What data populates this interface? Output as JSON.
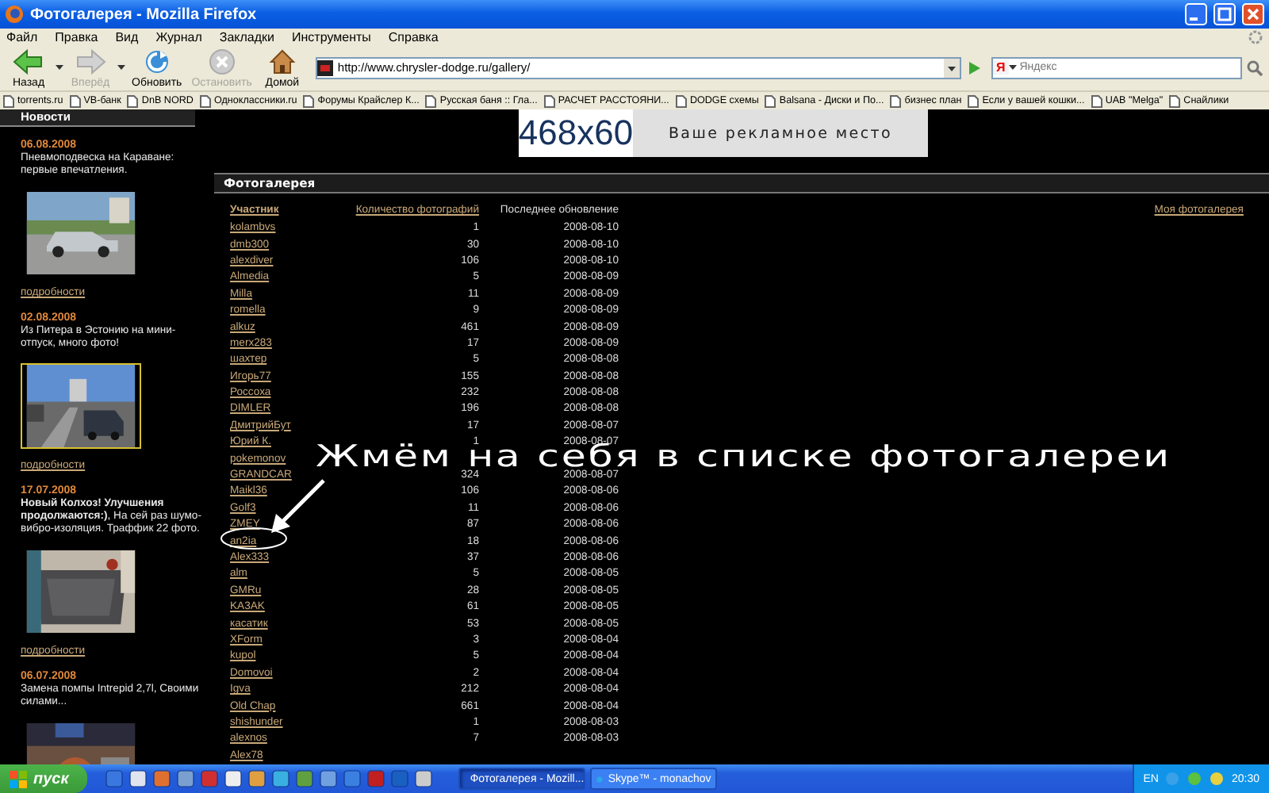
{
  "window": {
    "title": "Фотогалерея - Mozilla Firefox"
  },
  "menu": [
    "Файл",
    "Правка",
    "Вид",
    "Журнал",
    "Закладки",
    "Инструменты",
    "Справка"
  ],
  "toolbar": [
    {
      "kind": "back",
      "label": "Назад",
      "disabled": false,
      "menu": true
    },
    {
      "kind": "forward",
      "label": "Вперёд",
      "disabled": true,
      "menu": true
    },
    {
      "kind": "reload",
      "label": "Обновить",
      "disabled": false,
      "menu": false
    },
    {
      "kind": "stop",
      "label": "Остановить",
      "disabled": true,
      "menu": false
    },
    {
      "kind": "home",
      "label": "Домой",
      "disabled": false,
      "menu": false
    }
  ],
  "address": {
    "value": "http://www.chrysler-dodge.ru/gallery/"
  },
  "search": {
    "engine": "Я",
    "placeholder": "Яндекс"
  },
  "bookmarks": [
    "torrents.ru",
    "VB-банк",
    "DnB NORD",
    "Одноклассники.ru",
    "Форумы Крайслер К...",
    "Русская баня :: Гла...",
    "РАСЧЕТ РАССТОЯНИ...",
    "DODGE схемы",
    "Balsana - Диски и По...",
    "бизнес план",
    "Если у вашей кошки...",
    "UAB \"Melga\"",
    "Снайлики"
  ],
  "sidebar": {
    "title": "Новости",
    "items": [
      {
        "date": "06.08.2008",
        "text": "Пневмоподвеска на Караване: первые впечатления.",
        "framed": false,
        "link": "подробности"
      },
      {
        "date": "02.08.2008",
        "text": "Из Питера в Эстонию на мини-отпуск, много фото!",
        "framed": true,
        "link": "подробности"
      },
      {
        "date": "17.07.2008",
        "text": "**Новый Колхоз! Улучшения продолжаются:)**, На сей раз шумо-вибро-изоляция. Траффик 22 фото.",
        "framed": false,
        "link": "подробности"
      },
      {
        "date": "06.07.2008",
        "text": "Замена помпы Intrepid 2,7l, Своими силами...",
        "framed": false
      }
    ]
  },
  "banner": {
    "size": "468x60",
    "text": "Ваше рекламное место"
  },
  "gallery": {
    "title": "Фотогалерея",
    "my_link": "Моя фотогалерея",
    "columns": [
      {
        "label": "Участник",
        "link": true,
        "sorted": true
      },
      {
        "label": "Количество фотографий",
        "link": true,
        "sorted": false
      },
      {
        "label": "Последнее обновление",
        "link": false,
        "sorted": false
      }
    ],
    "rows": [
      {
        "member": "kolambvs",
        "photos": "1",
        "updated": "2008-08-10"
      },
      {
        "member": "dmb300",
        "photos": "30",
        "updated": "2008-08-10"
      },
      {
        "member": "alexdiver",
        "photos": "106",
        "updated": "2008-08-10"
      },
      {
        "member": "Almedia",
        "photos": "5",
        "updated": "2008-08-09"
      },
      {
        "member": "Milla",
        "photos": "11",
        "updated": "2008-08-09"
      },
      {
        "member": "romella",
        "photos": "9",
        "updated": "2008-08-09"
      },
      {
        "member": "alkuz",
        "photos": "461",
        "updated": "2008-08-09"
      },
      {
        "member": "merx283",
        "photos": "17",
        "updated": "2008-08-09"
      },
      {
        "member": "шахтер",
        "photos": "5",
        "updated": "2008-08-08"
      },
      {
        "member": "Игорь77",
        "photos": "155",
        "updated": "2008-08-08"
      },
      {
        "member": "Россоха",
        "photos": "232",
        "updated": "2008-08-08"
      },
      {
        "member": "DIMLER",
        "photos": "196",
        "updated": "2008-08-08"
      },
      {
        "member": "ДмитрийБут",
        "photos": "17",
        "updated": "2008-08-07"
      },
      {
        "member": "Юрий К.",
        "photos": "1",
        "updated": "2008-08-07"
      },
      {
        "member": "pokemonov"
      },
      {
        "member": "GRANDCAR",
        "photos": "324",
        "updated": "2008-08-07"
      },
      {
        "member": "Maikl36",
        "photos": "106",
        "updated": "2008-08-06"
      },
      {
        "member": "Golf3",
        "photos": "11",
        "updated": "2008-08-06"
      },
      {
        "member": "ZMEY",
        "photos": "87",
        "updated": "2008-08-06"
      },
      {
        "member": "an2ia",
        "photos": "18",
        "updated": "2008-08-06"
      },
      {
        "member": "Alex333",
        "photos": "37",
        "updated": "2008-08-06"
      },
      {
        "member": "alm",
        "photos": "5",
        "updated": "2008-08-05"
      },
      {
        "member": "GMRu",
        "photos": "28",
        "updated": "2008-08-05"
      },
      {
        "member": "KA3AK",
        "photos": "61",
        "updated": "2008-08-05"
      },
      {
        "member": "касатик",
        "photos": "53",
        "updated": "2008-08-05"
      },
      {
        "member": "XForm",
        "photos": "3",
        "updated": "2008-08-04"
      },
      {
        "member": "kupol",
        "photos": "5",
        "updated": "2008-08-04"
      },
      {
        "member": "Domovoi",
        "photos": "2",
        "updated": "2008-08-04"
      },
      {
        "member": "Igva",
        "photos": "212",
        "updated": "2008-08-04"
      },
      {
        "member": "Old Chap",
        "photos": "661",
        "updated": "2008-08-04"
      },
      {
        "member": "shishunder",
        "photos": "1",
        "updated": "2008-08-03"
      },
      {
        "member": "alexnos",
        "photos": "7",
        "updated": "2008-08-03"
      },
      {
        "member": "Alex78"
      }
    ]
  },
  "annotation": {
    "text": "Жмём на себя в списке фотогалереи"
  },
  "taskbar": {
    "start": "пуск",
    "tasks": [
      {
        "label": "Фотогалерея - Mozill...",
        "selected": true
      },
      {
        "label": "Skype™ - monachov",
        "selected": false
      }
    ],
    "language": "EN",
    "clock": "20:30"
  }
}
